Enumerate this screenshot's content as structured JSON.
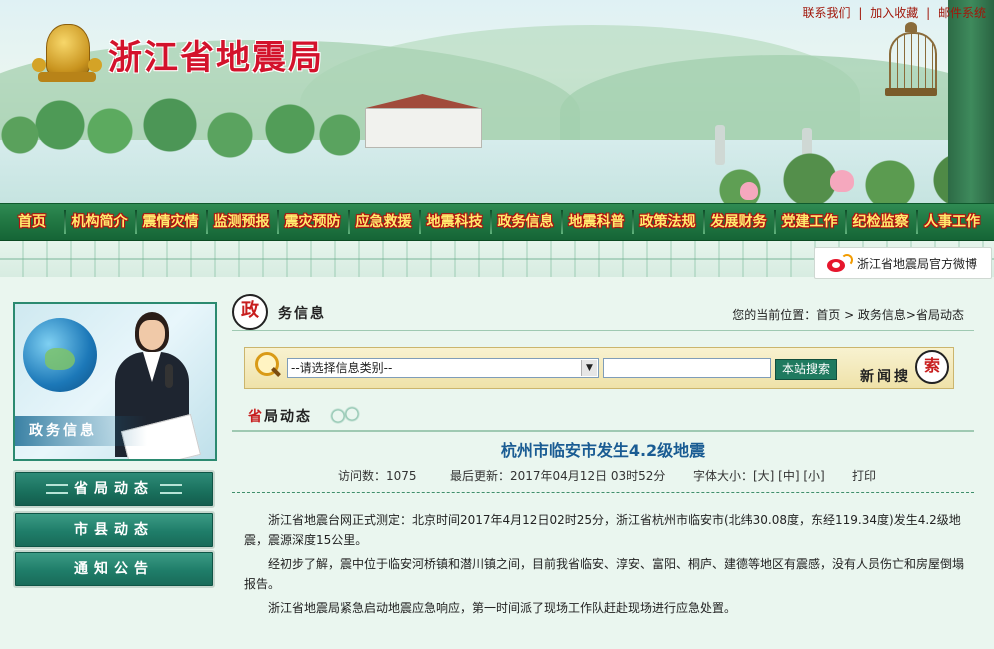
{
  "header": {
    "site_title": "浙江省地震局",
    "top_links": [
      "联系我们",
      "加入收藏",
      "邮件系统"
    ]
  },
  "nav": {
    "items": [
      "首页",
      "机构简介",
      "震情灾情",
      "监测预报",
      "震灾预防",
      "应急救援",
      "地震科技",
      "政务信息",
      "地震科普",
      "政策法规",
      "发展财务",
      "党建工作",
      "纪检监察",
      "人事工作"
    ]
  },
  "weibo": {
    "label": "浙江省地震局官方微博"
  },
  "sidebar": {
    "banner_label": "政务信息",
    "items": [
      {
        "label": "省局动态",
        "active": true
      },
      {
        "label": "市县动态",
        "active": false
      },
      {
        "label": "通知公告",
        "active": false
      }
    ]
  },
  "section": {
    "title_first_char": "政",
    "title_rest": "务信息",
    "breadcrumb": "您的当前位置：首页 > 政务信息>省局动态"
  },
  "search": {
    "category_placeholder": "--请选择信息类别--",
    "button_label": "本站搜索",
    "news_search_label": "新闻搜",
    "news_search_last_char": "索"
  },
  "subsection": {
    "first_char": "省",
    "rest": "局动态"
  },
  "article": {
    "title": "杭州市临安市发生4.2级地震",
    "visits_label": "访问数：1075",
    "updated_label": "最后更新：2017年04月12日 03时52分",
    "font_size_label": "字体大小：[大] [中] [小]",
    "print_label": "打印",
    "paragraphs": [
      "浙江省地震台网正式测定：北京时间2017年4月12日02时25分，浙江省杭州市临安市(北纬30.08度，东经119.34度)发生4.2级地震，震源深度15公里。",
      "经初步了解，震中位于临安河桥镇和潜川镇之间，目前我省临安、淳安、富阳、桐庐、建德等地区有震感，没有人员伤亡和房屋倒塌报告。",
      "浙江省地震局紧急启动地震应急响应，第一时间派了现场工作队赶赴现场进行应急处置。"
    ]
  },
  "colors": {
    "nav_green": "#237a45",
    "title_red": "#d3122b",
    "article_title_blue": "#1a5c93",
    "nav_text_yellow": "#ffeb6e"
  }
}
